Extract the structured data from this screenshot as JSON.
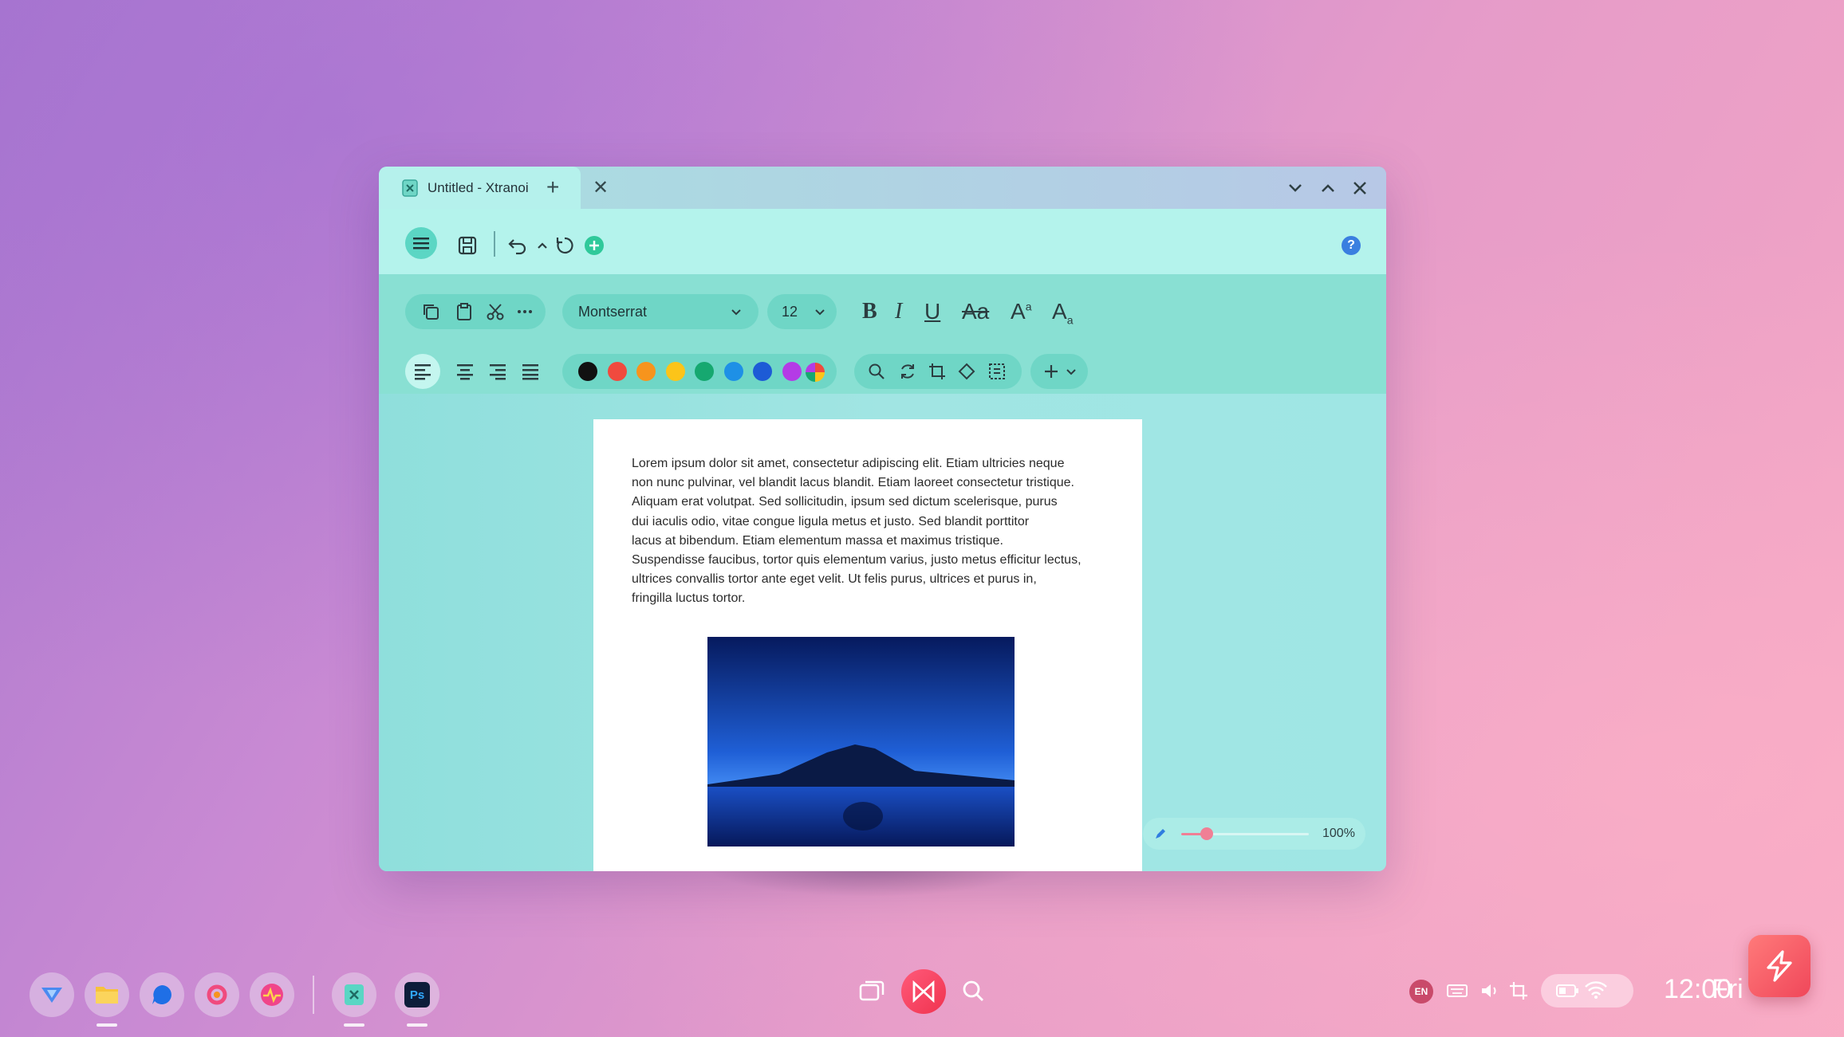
{
  "window": {
    "tab_title": "Untitled - Xtranoi",
    "icons": {
      "tab": "document-icon",
      "add_tab": "plus-icon",
      "close_tab": "close-icon",
      "minimize": "chevron-down-icon",
      "maximize": "chevron-up-icon",
      "close": "close-icon"
    }
  },
  "toolbar": {
    "icons": [
      "menu-icon",
      "save-icon",
      "undo-icon",
      "caret-up-icon",
      "refresh-icon",
      "add-circle-icon",
      "help-icon"
    ],
    "help_label": "?"
  },
  "format": {
    "font_family": "Montserrat",
    "font_size": "12",
    "clipboard_icons": [
      "copy-icon",
      "paste-icon",
      "scissors-icon",
      "more-icon"
    ],
    "style_buttons": {
      "bold": "B",
      "italic": "I",
      "underline": "U",
      "strike": "Aa",
      "superscript": "A",
      "subscript": "A"
    },
    "align_icons": [
      "align-left-icon",
      "align-center-icon",
      "align-right-icon",
      "align-justify-icon"
    ],
    "colors": [
      "#111111",
      "#f04a3e",
      "#f7941d",
      "#fcc419",
      "#16a870",
      "#1e90e6",
      "#1d5bd6",
      "#b43be6"
    ],
    "tool_icons": [
      "zoom-icon",
      "rotate-icon",
      "crop-icon",
      "shape-icon",
      "select-icon",
      "insert-icon"
    ]
  },
  "document": {
    "lines": [
      "Lorem ipsum dolor sit amet, consectetur adipiscing elit. Etiam ultricies neque",
      "non nunc pulvinar, vel blandit lacus blandit. Etiam laoreet consectetur tristique.",
      "Aliquam erat volutpat. Sed sollicitudin, ipsum sed dictum scelerisque, purus",
      "dui iaculis odio, vitae congue ligula metus et justo. Sed blandit porttitor",
      "lacus at bibendum. Etiam elementum massa et maximus tristique.",
      "Suspendisse faucibus, tortor quis elementum varius, justo metus efficitur lectus,",
      "ultrices convallis tortor ante eget velit. Ut felis purus, ultrices et purus in,",
      "fringilla luctus tortor."
    ]
  },
  "zoom": {
    "value_label": "100%",
    "level": 0.2
  },
  "taskbar": {
    "dock": [
      "browser-icon",
      "folder-icon",
      "chat-icon",
      "pinwheel-icon",
      "activity-icon",
      "document-app-icon",
      "photoshop-icon"
    ],
    "photoshop_label": "Ps",
    "center": [
      "windows-icon",
      "launcher-icon",
      "search-icon"
    ],
    "language": "EN",
    "time": "12:00",
    "day": "Fri"
  }
}
